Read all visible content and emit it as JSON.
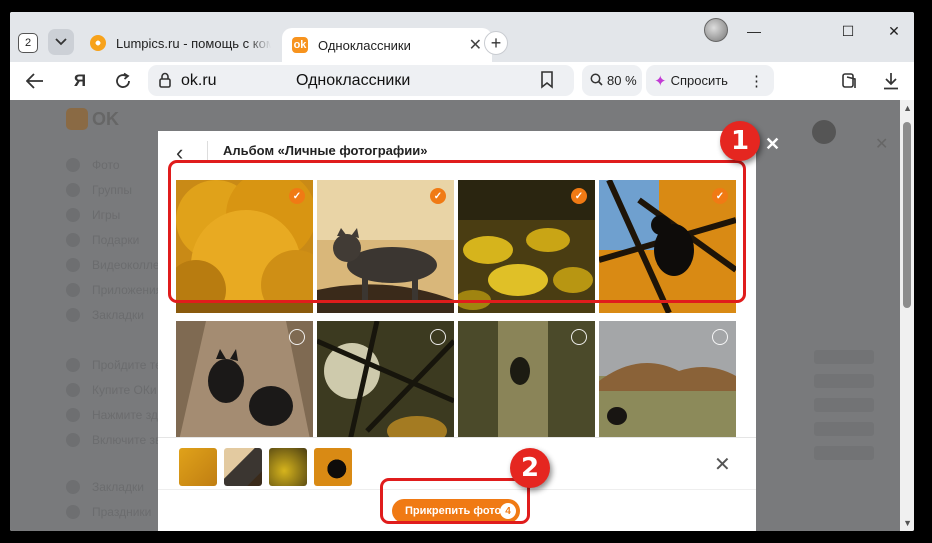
{
  "browser": {
    "tab_count": "2",
    "tabs": [
      {
        "title": "Lumpics.ru - помощь с компьютером",
        "active": false
      },
      {
        "title": "Одноклассники",
        "active": true
      }
    ],
    "new_tab": "+",
    "window_controls": {
      "minimize": "—",
      "maximize": "☐",
      "close": "✕"
    },
    "address": {
      "host": "ok.ru",
      "page_title": "Одноклассники"
    },
    "zoom": "80 %",
    "ask_label": "Спросить",
    "more": "⋮",
    "yandex_button": "Я"
  },
  "page": {
    "logo_text": "OK",
    "sidebar_items": [
      "Фото",
      "Группы",
      "Игры",
      "Подарки",
      "Видеоколлекция",
      "Приложения",
      "Закладки"
    ],
    "sidebar_items_lower": [
      "Пройдите тест",
      "Купите ОКи",
      "Нажмите здесь",
      "Включите звук"
    ],
    "sidebar_items_bottom": [
      "Закладки",
      "Праздники"
    ]
  },
  "modal": {
    "title": "Альбом «Личные фотографии»",
    "back": "‹",
    "photos": [
      {
        "id": "autumn-tree",
        "selected": true
      },
      {
        "id": "tabby-cat-on-branch",
        "selected": true
      },
      {
        "id": "yellow-leaves",
        "selected": true
      },
      {
        "id": "black-cat-in-tree",
        "selected": true
      },
      {
        "id": "two-dogs-on-path",
        "selected": false
      },
      {
        "id": "sun-through-branches",
        "selected": false
      },
      {
        "id": "cat-on-tree-trunk",
        "selected": false
      },
      {
        "id": "dog-in-autumn-field",
        "selected": false
      }
    ],
    "attach_button": "Прикрепить фото",
    "attach_count": "4",
    "close": "✕"
  },
  "annotations": {
    "badge_1": "1",
    "badge_2": "2"
  },
  "colors": {
    "ok_orange": "#f07a14",
    "annotation_red": "#e01c1c"
  }
}
